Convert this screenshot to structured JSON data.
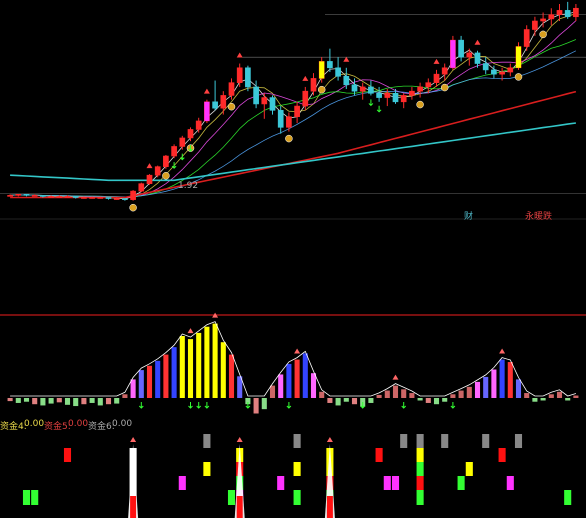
{
  "price_panel": {
    "price_tag": "1.92",
    "legend_1": "财",
    "legend_2": "永暖跌"
  },
  "fund_legend": {
    "f4_label": "资金4:",
    "f4_value": "0.00",
    "f5_label": "资金5:",
    "f5_value": "0.00",
    "f6_label": "资金6:",
    "f6_value": "0.00"
  },
  "colors": {
    "background": "#000000",
    "bull_candle": "#ff2a2a",
    "bear_candle": "#3cc8d8",
    "ma_long_red": "#d81e1e",
    "ma_long_cyan": "#33c6c8",
    "highlight_yellow": "#ffff00",
    "highlight_magenta": "#ff33ff",
    "signal_green": "#33ff33",
    "signal_grey": "#888888",
    "separator": "#c01818"
  },
  "icons": [
    "diamond-marker-icon",
    "gold-coin-icon",
    "buy-arrow-icon",
    "cross-signal-icon"
  ],
  "chart_data": [
    {
      "type": "candlestick",
      "title": "",
      "series": [
        {
          "name": "",
          "values": [
            [
              1.9,
              1.91,
              1.89,
              1.9
            ],
            [
              1.9,
              1.91,
              1.89,
              1.91
            ],
            [
              1.91,
              1.91,
              1.89,
              1.9
            ],
            [
              1.9,
              1.91,
              1.89,
              1.9
            ],
            [
              1.9,
              1.9,
              1.88,
              1.89
            ],
            [
              1.89,
              1.9,
              1.88,
              1.89
            ],
            [
              1.89,
              1.9,
              1.88,
              1.89
            ],
            [
              1.89,
              1.9,
              1.88,
              1.89
            ],
            [
              1.89,
              1.89,
              1.87,
              1.88
            ],
            [
              1.88,
              1.89,
              1.87,
              1.88
            ],
            [
              1.88,
              1.89,
              1.87,
              1.88
            ],
            [
              1.88,
              1.89,
              1.87,
              1.88
            ],
            [
              1.88,
              1.88,
              1.86,
              1.87
            ],
            [
              1.87,
              1.88,
              1.86,
              1.87
            ],
            [
              1.87,
              1.87,
              1.85,
              1.86
            ],
            [
              1.86,
              1.95,
              1.85,
              1.94
            ],
            [
              1.94,
              2.02,
              1.93,
              2.01
            ],
            [
              2.01,
              2.1,
              2.0,
              2.09
            ],
            [
              2.09,
              2.18,
              2.07,
              2.17
            ],
            [
              2.17,
              2.28,
              2.15,
              2.27
            ],
            [
              2.27,
              2.38,
              2.25,
              2.36
            ],
            [
              2.36,
              2.46,
              2.33,
              2.44
            ],
            [
              2.44,
              2.54,
              2.41,
              2.52
            ],
            [
              2.52,
              2.63,
              2.49,
              2.6
            ],
            [
              2.6,
              2.8,
              2.58,
              2.78
            ],
            [
              2.78,
              2.98,
              2.7,
              2.72
            ],
            [
              2.72,
              2.88,
              2.66,
              2.84
            ],
            [
              2.84,
              3.0,
              2.8,
              2.96
            ],
            [
              2.96,
              3.14,
              2.92,
              3.1
            ],
            [
              3.1,
              3.12,
              2.88,
              2.92
            ],
            [
              2.92,
              2.98,
              2.72,
              2.76
            ],
            [
              2.76,
              2.86,
              2.62,
              2.82
            ],
            [
              2.82,
              2.84,
              2.66,
              2.7
            ],
            [
              2.7,
              2.74,
              2.48,
              2.54
            ],
            [
              2.54,
              2.68,
              2.5,
              2.64
            ],
            [
              2.64,
              2.78,
              2.58,
              2.74
            ],
            [
              2.74,
              2.92,
              2.7,
              2.88
            ],
            [
              2.88,
              3.05,
              2.84,
              3.0
            ],
            [
              3.0,
              3.2,
              2.96,
              3.16
            ],
            [
              3.16,
              3.28,
              3.06,
              3.1
            ],
            [
              3.1,
              3.2,
              2.98,
              3.02
            ],
            [
              3.02,
              3.1,
              2.9,
              2.94
            ],
            [
              2.94,
              3.0,
              2.84,
              2.88
            ],
            [
              2.88,
              2.96,
              2.8,
              2.92
            ],
            [
              2.92,
              2.98,
              2.84,
              2.86
            ],
            [
              2.86,
              2.92,
              2.78,
              2.82
            ],
            [
              2.82,
              2.9,
              2.74,
              2.86
            ],
            [
              2.86,
              2.9,
              2.76,
              2.78
            ],
            [
              2.78,
              2.86,
              2.72,
              2.84
            ],
            [
              2.84,
              2.92,
              2.8,
              2.88
            ],
            [
              2.88,
              2.96,
              2.82,
              2.92
            ],
            [
              2.92,
              3.0,
              2.86,
              2.96
            ],
            [
              2.96,
              3.08,
              2.92,
              3.04
            ],
            [
              3.04,
              3.14,
              2.98,
              3.1
            ],
            [
              3.1,
              3.4,
              3.08,
              3.36
            ],
            [
              3.36,
              3.4,
              3.16,
              3.2
            ],
            [
              3.2,
              3.28,
              3.12,
              3.24
            ],
            [
              3.24,
              3.26,
              3.1,
              3.14
            ],
            [
              3.14,
              3.2,
              3.04,
              3.08
            ],
            [
              3.08,
              3.12,
              3.0,
              3.04
            ],
            [
              3.04,
              3.1,
              2.98,
              3.06
            ],
            [
              3.06,
              3.14,
              3.02,
              3.1
            ],
            [
              3.1,
              3.34,
              3.08,
              3.3
            ],
            [
              3.3,
              3.5,
              3.26,
              3.46
            ],
            [
              3.46,
              3.58,
              3.4,
              3.54
            ],
            [
              3.54,
              3.62,
              3.48,
              3.56
            ],
            [
              3.56,
              3.66,
              3.5,
              3.6
            ],
            [
              3.6,
              3.7,
              3.54,
              3.64
            ],
            [
              3.64,
              3.72,
              3.56,
              3.58
            ],
            [
              3.58,
              3.7,
              3.54,
              3.66
            ]
          ]
        }
      ]
    },
    {
      "type": "bar",
      "title": "",
      "values": [
        -0.05,
        -0.08,
        -0.06,
        -0.1,
        -0.12,
        -0.09,
        -0.07,
        -0.11,
        -0.13,
        -0.1,
        -0.08,
        -0.12,
        -0.1,
        -0.09,
        0.06,
        0.3,
        0.45,
        0.52,
        0.6,
        0.7,
        0.82,
        1.0,
        0.95,
        1.05,
        1.15,
        1.2,
        0.9,
        0.7,
        0.35,
        -0.1,
        -0.25,
        -0.18,
        0.2,
        0.38,
        0.55,
        0.62,
        0.72,
        0.4,
        0.1,
        -0.08,
        -0.12,
        -0.06,
        -0.1,
        -0.14,
        -0.08,
        0.05,
        0.12,
        0.2,
        0.14,
        0.08,
        -0.04,
        -0.08,
        -0.1,
        -0.06,
        0.06,
        0.12,
        0.18,
        0.26,
        0.34,
        0.46,
        0.62,
        0.58,
        0.3,
        0.08,
        -0.06,
        -0.04,
        0.06,
        0.1,
        -0.04,
        0.04
      ]
    },
    {
      "type": "bar",
      "title": "",
      "series": [
        {
          "name": "资金4",
          "values": [
            0,
            0,
            0,
            0,
            0,
            0,
            0,
            0,
            0,
            0,
            0,
            0,
            0,
            0,
            0,
            0,
            0,
            0,
            0,
            0,
            0,
            0,
            0,
            0,
            0,
            0,
            0,
            0,
            0,
            0,
            0,
            0,
            0,
            0,
            0,
            0,
            0,
            0,
            0,
            0,
            0,
            0,
            0,
            0,
            0,
            0,
            0,
            0,
            0,
            0,
            0,
            0,
            0,
            0,
            0,
            0,
            0,
            0,
            0,
            0,
            0,
            0,
            0,
            0,
            0,
            0,
            0,
            0,
            0,
            0
          ]
        },
        {
          "name": "资金5",
          "values": [
            0,
            0,
            0,
            0,
            0,
            0,
            0,
            0,
            0,
            0,
            0,
            0,
            0,
            0,
            0,
            0,
            0,
            0,
            0,
            0,
            0,
            0,
            0,
            0,
            0,
            0,
            0,
            0,
            0,
            0,
            0,
            0,
            0,
            0,
            0,
            0,
            0,
            0,
            0,
            0,
            0,
            0,
            0,
            0,
            0,
            0,
            0,
            0,
            0,
            0,
            0,
            0,
            0,
            0,
            0,
            0,
            0,
            0,
            0,
            0,
            0,
            0,
            0,
            0,
            0,
            0,
            0,
            0,
            0,
            0
          ]
        },
        {
          "name": "资金6",
          "values": [
            0,
            0,
            0,
            0,
            0,
            0,
            0,
            0,
            0,
            0,
            0,
            0,
            0,
            0,
            0,
            0,
            0,
            0,
            0,
            0,
            0,
            0,
            0,
            0,
            0,
            0,
            0,
            0,
            0,
            0,
            0,
            0,
            0,
            0,
            0,
            0,
            0,
            0,
            0,
            0,
            0,
            0,
            0,
            0,
            0,
            0,
            0,
            0,
            0,
            0,
            0,
            0,
            0,
            0,
            0,
            0,
            0,
            0,
            0,
            0,
            0,
            0,
            0,
            0,
            0,
            0,
            0,
            0,
            0,
            0
          ]
        }
      ]
    }
  ]
}
